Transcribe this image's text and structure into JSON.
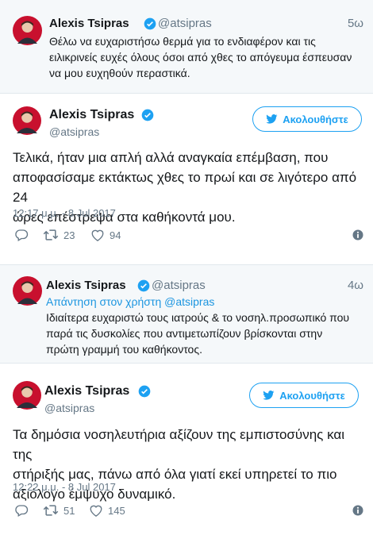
{
  "colors": {
    "accent": "#1da1f2",
    "muted": "#657786",
    "parent_bg": "#f5f8fa"
  },
  "tweets": [
    {
      "kind": "parent",
      "name": "Alexis Tsipras",
      "handle": "@atsipras",
      "time": "5ω",
      "text_lines": [
        "Θέλω να ευχαριστήσω θερμά για το ενδιαφέρον και τις",
        "ειλικρινείς ευχές όλους όσοι από χθες το απόγευμα έσπευσαν",
        "να μου ευχηθούν περαστικά."
      ]
    },
    {
      "kind": "main",
      "name": "Alexis Tsipras",
      "handle": "@atsipras",
      "follow_label": "Ακολουθήστε",
      "text_lines": [
        "Τελικά, ήταν μια απλή αλλά αναγκαία επέμβαση, που",
        "αποφασίσαμε εκτάκτως χθες το πρωί και σε λιγότερο από 24",
        "ώρες επέστρεψα στα καθήκοντά μου."
      ],
      "date": "12:17 μ.μ. - 8 Jul 2017",
      "retweets": "23",
      "likes": "94",
      "icons": {
        "reply": "reply-icon",
        "retweet": "retweet-icon",
        "like": "heart-icon",
        "info": "info-icon"
      }
    },
    {
      "kind": "parent",
      "name": "Alexis Tsipras",
      "handle": "@atsipras",
      "time": "4ω",
      "reply_to": "Απάντηση στον χρήστη @atsipras",
      "text_lines": [
        "Ιδιαίτερα ευχαριστώ τους ιατρούς & το νοσηλ.προσωπικό που",
        "παρά τις δυσκολίες που αντιμετωπίζουν βρίσκονται στην",
        "πρώτη γραμμή του καθήκοντος."
      ]
    },
    {
      "kind": "main",
      "name": "Alexis Tsipras",
      "handle": "@atsipras",
      "follow_label": "Ακολουθήστε",
      "text_lines": [
        "Τα δημόσια νοσηλευτήρια αξίζουν της εμπιστοσύνης και της",
        "στήριξής μας, πάνω από όλα γιατί εκεί υπηρετεί το πιο",
        "αξιόλογο έμψυχο δυναμικό."
      ],
      "date": "12:22 μ.μ. - 8 Jul 2017",
      "retweets": "51",
      "likes": "145",
      "icons": {
        "reply": "reply-icon",
        "retweet": "retweet-icon",
        "like": "heart-icon",
        "info": "info-icon"
      }
    }
  ]
}
